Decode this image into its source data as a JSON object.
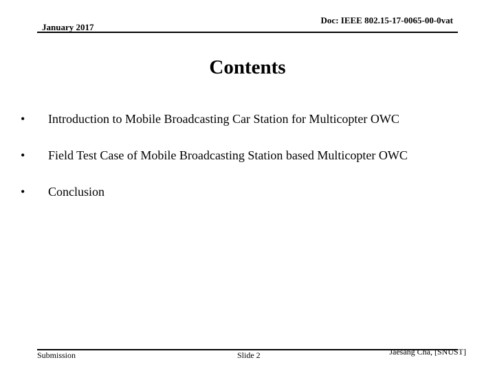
{
  "header": {
    "date": "January 2017",
    "doc_id": "Doc: IEEE 802.15-17-0065-00-0vat"
  },
  "title": "Contents",
  "bullets": [
    {
      "mark": "•",
      "text": "Introduction to Mobile Broadcasting Car Station for Multicopter OWC"
    },
    {
      "mark": "•",
      "text": "Field Test Case of Mobile Broadcasting Station based Multicopter OWC"
    },
    {
      "mark": "•",
      "text": "Conclusion"
    }
  ],
  "footer": {
    "left": "Submission",
    "center": "Slide 2",
    "right": "Jaesang Cha, [SNUST]"
  }
}
